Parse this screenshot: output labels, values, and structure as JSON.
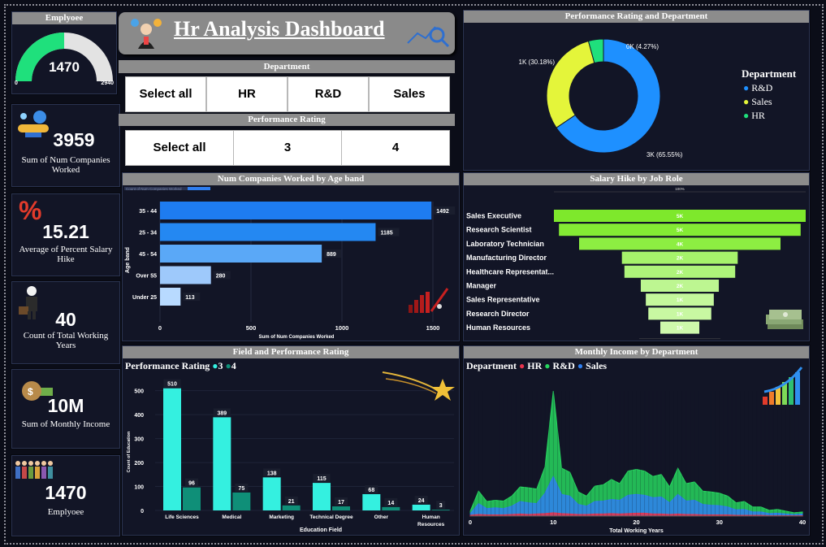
{
  "title": "Hr Analysis Dashboard",
  "gauge": {
    "header": "Emplyoee",
    "value": "1470",
    "min": "0",
    "max": "2940",
    "fraction": 0.5,
    "color": "#1fe07c"
  },
  "kpis": [
    {
      "value": "3959",
      "label": "Sum of Num Companies Worked",
      "icon": "handshake-icon"
    },
    {
      "value": "15.21",
      "label": "Average of Percent Salary Hike",
      "icon": "percent-icon"
    },
    {
      "value": "40",
      "label": "Count of Total Working Years",
      "icon": "businessman-icon"
    },
    {
      "value": "10M",
      "label": "Sum of Monthly Income",
      "icon": "money-bag-icon"
    },
    {
      "value": "1470",
      "label": "Emplyoee",
      "icon": "people-icon"
    }
  ],
  "department_slicer": {
    "header": "Department",
    "options": [
      "Select all",
      "HR",
      "R&D",
      "Sales"
    ]
  },
  "rating_slicer": {
    "header": "Performance Rating",
    "options": [
      "Select all",
      "3",
      "4"
    ]
  },
  "donut": {
    "header": "Performance Rating and Department",
    "legend_title": "Department",
    "chart_data": {
      "type": "pie",
      "series": [
        {
          "name": "R&D",
          "value": 65.55,
          "label": "3K (65.55%)",
          "color": "#1e90ff"
        },
        {
          "name": "Sales",
          "value": 30.18,
          "label": "1K (30.18%)",
          "color": "#e4f53a"
        },
        {
          "name": "HR",
          "value": 4.27,
          "label": "0K (4.27%)",
          "color": "#1fe07c"
        }
      ]
    }
  },
  "bar_age": {
    "header": "Num Companies Worked by Age band",
    "legend_caption": "Count of Num Companies Worked",
    "chart_data": {
      "type": "bar",
      "orientation": "horizontal",
      "categories": [
        "35 - 44",
        "25 - 34",
        "45 - 54",
        "Over 55",
        "Under 25"
      ],
      "values": [
        1492,
        1185,
        889,
        280,
        113
      ],
      "xlabel": "Sum of Num Companies Worked",
      "ylabel": "Age band",
      "xticks": [
        "0",
        "500",
        "1000",
        "1500"
      ],
      "xlim": [
        0,
        1500
      ],
      "colors": [
        "#1e7cf0",
        "#2488f2",
        "#5aa8f7",
        "#9ec9fb",
        "#b8daff"
      ]
    }
  },
  "funnel": {
    "header": "Salary Hike by Job Role",
    "top_label": "100%",
    "bottom_label": "15.5%",
    "chart_data": {
      "type": "bar",
      "categories": [
        "Sales Executive",
        "Research Scientist",
        "Laboratory Technician",
        "Manufacturing Director",
        "Healthcare Representat...",
        "Manager",
        "Sales Representative",
        "Research Director",
        "Human Resources"
      ],
      "values": [
        100,
        96,
        80,
        46,
        44,
        31,
        27,
        25,
        15.5
      ],
      "labels": [
        "5K",
        "5K",
        "4K",
        "2K",
        "2K",
        "2K",
        "1K",
        "1K",
        "1K"
      ],
      "colors": [
        "#7ee82c",
        "#84eb34",
        "#8dee42",
        "#a6f36b",
        "#aef47a",
        "#bdf691",
        "#c4f79c",
        "#c8f8a2",
        "#cef9ab"
      ]
    }
  },
  "field_rating": {
    "header": "Field and Performance Rating",
    "legend_title": "Performance Rating",
    "chart_data": {
      "type": "bar",
      "categories": [
        "Life Sciences",
        "Medical",
        "Marketing",
        "Technical Degree",
        "Other",
        "Human Resources"
      ],
      "series": [
        {
          "name": "3",
          "values": [
            510,
            389,
            138,
            115,
            68,
            24
          ],
          "color": "#34f0e0"
        },
        {
          "name": "4",
          "values": [
            96,
            75,
            21,
            17,
            14,
            3
          ],
          "color": "#0f8f78"
        }
      ],
      "xlabel": "Education Field",
      "ylabel": "Count of Education",
      "yticks": [
        "0",
        "100",
        "200",
        "300",
        "400",
        "500"
      ],
      "ylim": [
        0,
        560
      ]
    }
  },
  "income": {
    "header": "Monthly Income by Department",
    "legend_title": "Department",
    "chart_data": {
      "type": "area",
      "x": [
        0,
        1,
        2,
        3,
        4,
        5,
        6,
        7,
        8,
        9,
        10,
        11,
        12,
        13,
        14,
        15,
        16,
        17,
        18,
        19,
        20,
        21,
        22,
        23,
        24,
        25,
        26,
        27,
        28,
        29,
        30,
        31,
        32,
        33,
        34,
        35,
        36,
        37,
        38,
        39,
        40
      ],
      "series": [
        {
          "name": "HR",
          "color": "#e8344d",
          "values": [
            2,
            4,
            3,
            3,
            3,
            4,
            5,
            4,
            5,
            6,
            8,
            6,
            5,
            4,
            4,
            5,
            5,
            6,
            5,
            6,
            7,
            7,
            5,
            5,
            4,
            5,
            4,
            4,
            3,
            3,
            3,
            3,
            2,
            2,
            2,
            2,
            1,
            1,
            1,
            1,
            1
          ]
        },
        {
          "name": "R&D",
          "color": "#27d65f",
          "values": [
            12,
            60,
            35,
            38,
            36,
            48,
            70,
            68,
            65,
            118,
            300,
            115,
            105,
            58,
            48,
            72,
            75,
            88,
            78,
            108,
            112,
            108,
            95,
            100,
            70,
            115,
            78,
            82,
            60,
            58,
            55,
            48,
            32,
            35,
            22,
            22,
            14,
            16,
            12,
            8,
            10
          ]
        },
        {
          "name": "Sales",
          "color": "#2f7ff0",
          "values": [
            6,
            30,
            18,
            20,
            18,
            24,
            35,
            32,
            30,
            55,
            95,
            52,
            48,
            28,
            24,
            35,
            36,
            40,
            38,
            50,
            52,
            50,
            44,
            46,
            32,
            52,
            36,
            38,
            28,
            26,
            25,
            22,
            15,
            16,
            10,
            10,
            6,
            7,
            5,
            4,
            5
          ]
        }
      ],
      "xlabel": "Total Working Years",
      "xticks": [
        "0",
        "10",
        "20",
        "30",
        "40"
      ],
      "xlim": [
        0,
        40
      ]
    }
  }
}
